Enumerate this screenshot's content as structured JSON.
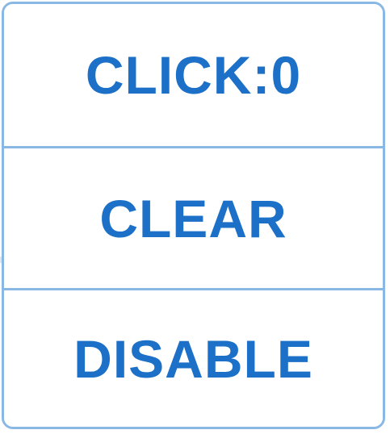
{
  "buttons": [
    {
      "label": "CLICK:0"
    },
    {
      "label": "CLEAR"
    },
    {
      "label": "DISABLE"
    }
  ],
  "colors": {
    "text": "#1d70c8",
    "border": "#8ab8e4",
    "background": "#ffffff"
  }
}
